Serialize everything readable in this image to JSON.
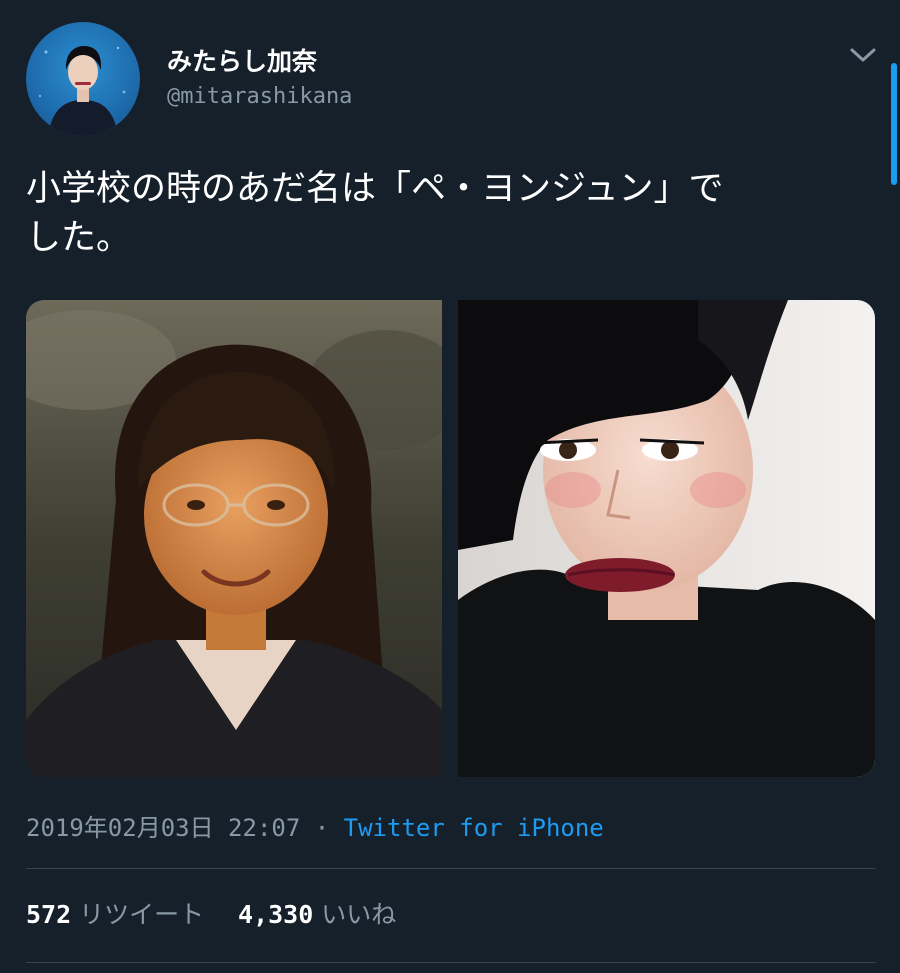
{
  "tweet": {
    "author": {
      "display_name": "みたらし加奈",
      "handle": "@mitarashikana"
    },
    "text_line1": "小学校の時のあだ名は「ペ・ヨンジュン」で",
    "text_line2": "した。",
    "timestamp": "2019年02月03日 22:07",
    "separator": "·",
    "source": "Twitter for iPhone",
    "stats": {
      "retweets_count": "572",
      "retweets_label": "リツイート",
      "likes_count": "4,330",
      "likes_label": "いいね"
    }
  },
  "icons": {
    "menu": "chevron-down-icon"
  },
  "colors": {
    "background": "#15202b",
    "text_primary": "#ffffff",
    "text_secondary": "#8899a6",
    "link": "#1d9bf0",
    "divider": "#38444d"
  }
}
